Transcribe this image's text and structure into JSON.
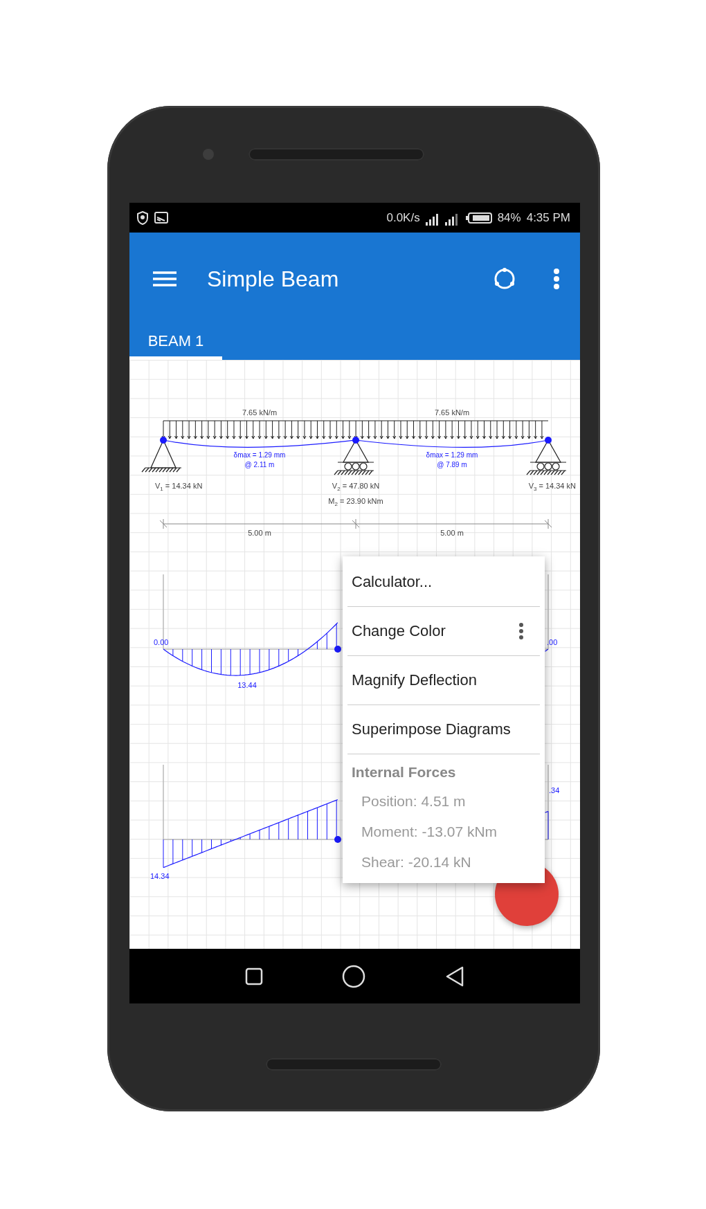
{
  "status_bar": {
    "network_speed": "0.0K/s",
    "battery": "84%",
    "time": "4:35 PM"
  },
  "app_bar": {
    "title": "Simple Beam"
  },
  "tabs": [
    {
      "label": "BEAM 1",
      "selected": true
    }
  ],
  "beam": {
    "spans": [
      {
        "load": "7.65 kN/m",
        "deflection": "δmax = 1.29 mm",
        "deflection_position": "@ 2.11 m",
        "length": "5.00 m"
      },
      {
        "load": "7.65 kN/m",
        "deflection": "δmax = 1.29 mm",
        "deflection_position": "@ 7.89 m",
        "length": "5.00 m"
      }
    ],
    "supports": [
      {
        "kind": "pin",
        "reaction": {
          "symbol": "V",
          "index": "1",
          "value": " = 14.34 kN"
        }
      },
      {
        "kind": "roller",
        "reaction": {
          "symbol": "V",
          "index": "2",
          "value": " = 47.80 kN"
        },
        "moment": {
          "symbol": "M",
          "index": "2",
          "value": " = 23.90 kNm"
        }
      },
      {
        "kind": "roller",
        "reaction": {
          "symbol": "V",
          "index": "3",
          "value": " = 14.34 kN"
        }
      }
    ]
  },
  "moment_diagram": {
    "start_label": "0.00",
    "peak_label": "13.44",
    "edge_label": ".00"
  },
  "shear_diagram": {
    "start_label": "14.34",
    "edge_label": ".34"
  },
  "menu": {
    "items": [
      {
        "label": "Calculator...",
        "kind": "action"
      },
      {
        "label": "Change Color",
        "kind": "more"
      },
      {
        "label": "Magnify Deflection",
        "kind": "action"
      },
      {
        "label": "Superimpose Diagrams",
        "kind": "action"
      }
    ],
    "section": {
      "title": "Internal Forces",
      "lines": [
        "Position: 4.51 m",
        "Moment: -13.07 kNm",
        "Shear: -20.14 kN"
      ]
    }
  }
}
